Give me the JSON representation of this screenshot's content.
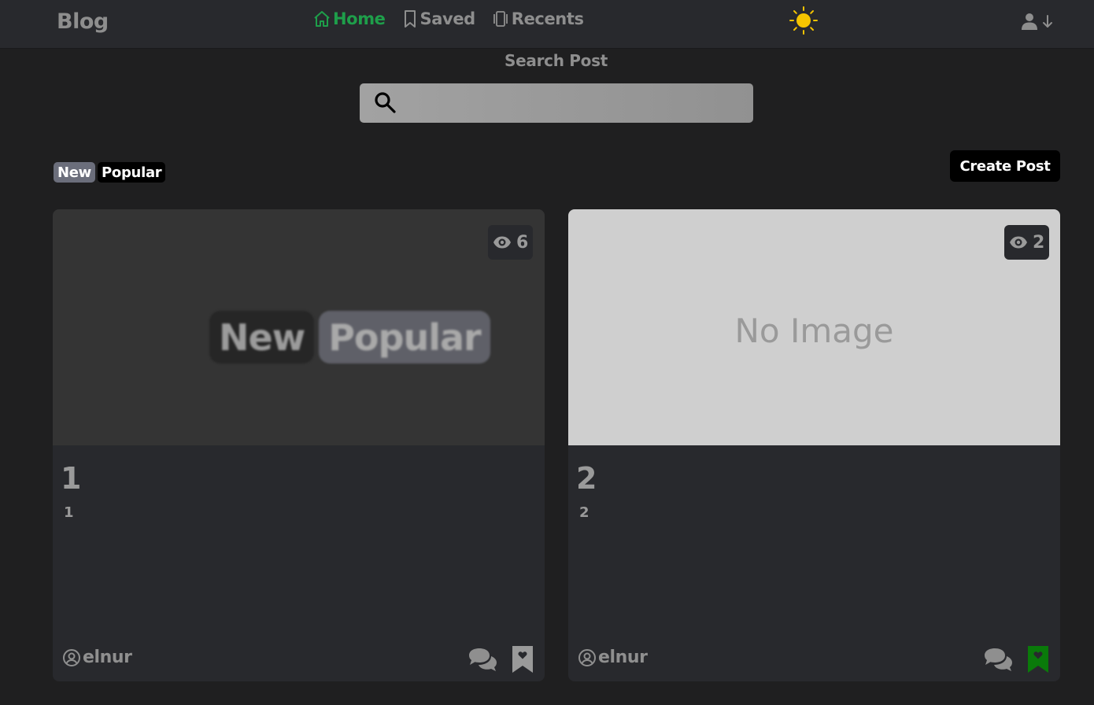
{
  "header": {
    "brand": "Blog",
    "nav": [
      {
        "label": "Home",
        "icon": "home-icon",
        "active": true
      },
      {
        "label": "Saved",
        "icon": "bookmark-icon",
        "active": false
      },
      {
        "label": "Recents",
        "icon": "recents-icon",
        "active": false
      }
    ],
    "theme_icon": "sun-icon",
    "user_icons": [
      "user-icon",
      "arrow-down-icon"
    ]
  },
  "search": {
    "label": "Search Post",
    "placeholder": "",
    "value": ""
  },
  "filters": {
    "new_label": "New",
    "popular_label": "Popular"
  },
  "create_button": "Create Post",
  "posts": [
    {
      "views": "6",
      "image_text": {
        "new": "New",
        "popular": "Popular"
      },
      "title": "1",
      "body": "1",
      "author": "elnur",
      "saved": false
    },
    {
      "views": "2",
      "image_text": "No Image",
      "title": "2",
      "body": "2",
      "author": "elnur",
      "saved": true
    }
  ],
  "colors": {
    "accent": "#1e9e4a",
    "sun": "#f5c400",
    "saved_bookmark": "#0a7a0a",
    "unsaved_bookmark": "#9a9a9a"
  }
}
